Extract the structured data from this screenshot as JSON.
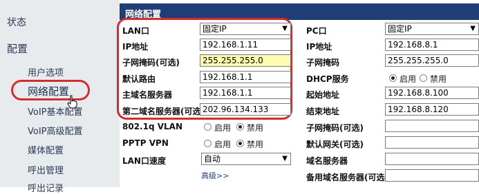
{
  "nav": {
    "status": "状态",
    "config": "配置",
    "user_options": "用户选项",
    "network_config": "网络配置",
    "voip_basic": "VoIP基本配置",
    "voip_advanced": "VoIP高级配置",
    "media_config": "媒体配置",
    "call_management": "呼出管理",
    "call_log": "呼出记录"
  },
  "main": {
    "title": "网络配置",
    "left": {
      "lan_port_label": "LAN口",
      "lan_port_value": "固定IP",
      "ip_label": "IP地址",
      "ip_value": "192.168.1.11",
      "mask_label": "子网掩码(可选)",
      "mask_value": "255.255.255.0",
      "gateway_label": "默认路由",
      "gateway_value": "192.168.1.1",
      "dns1_label": "主域名服务器",
      "dns1_value": "192.168.1.1",
      "dns2_label": "第二域名服务器(可选)",
      "dns2_value": "202.96.134.133",
      "vlan_label": "802.1q VLAN",
      "vlan_enable": "启用",
      "vlan_disable": "禁用",
      "pptp_label": "PPTP VPN",
      "pptp_enable": "启用",
      "pptp_disable": "禁用",
      "lan_speed_label": "LAN口速度",
      "lan_speed_value": "自动",
      "advanced_link": "高级>>"
    },
    "right": {
      "pc_port_label": "PC口",
      "pc_port_value": "固定IP",
      "ip_label": "IP地址",
      "ip_value": "192.168.8.1",
      "mask_label": "子网掩码",
      "mask_value": "255.255.255.0",
      "dhcp_label": "DHCP服务",
      "dhcp_enable": "启用",
      "dhcp_disable": "禁用",
      "start_label": "起始地址",
      "start_value": "192.168.8.100",
      "end_label": "结束地址",
      "end_value": "192.168.8.120",
      "mask_opt_label": "子网掩码(可选)",
      "mask_opt_value": "",
      "gw_opt_label": "默认网关(可选)",
      "gw_opt_value": "",
      "dns_label": "域名服务器",
      "dns_value": "",
      "dns_backup_label": "备用域名服务器(可选)",
      "dns_backup_value": ""
    }
  },
  "colors": {
    "title_bar": "#1f3e76",
    "highlight": "#d42c2c",
    "nav_bg": "#e8ebee"
  }
}
